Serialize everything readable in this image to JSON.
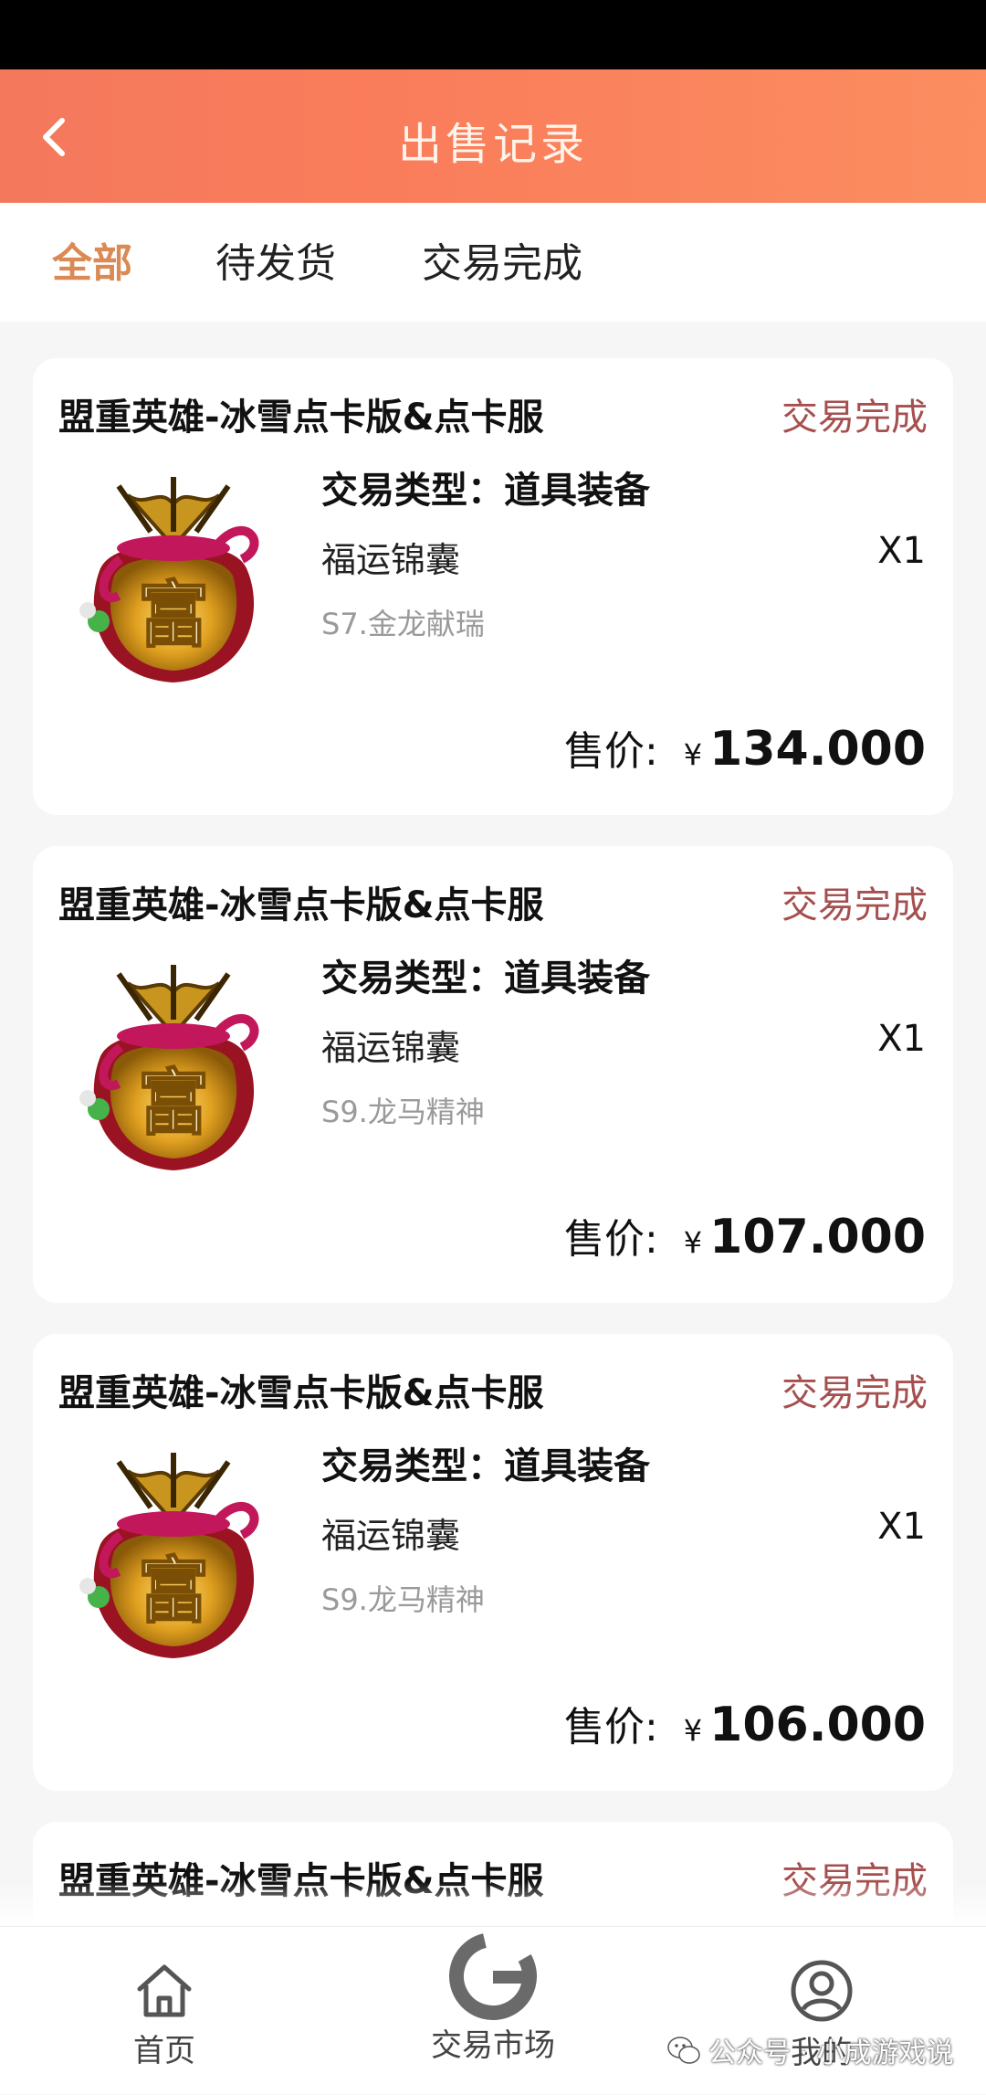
{
  "header": {
    "title": "出售记录"
  },
  "tabs": [
    {
      "label": "全部",
      "active": true
    },
    {
      "label": "待发货",
      "active": false
    },
    {
      "label": "交易完成",
      "active": false
    }
  ],
  "records": [
    {
      "game": "盟重英雄-冰雪点卡版&点卡服",
      "status": "交易完成",
      "trade_type": "交易类型：道具装备",
      "item": "福运锦囊",
      "quantity": "X1",
      "server": "S7.金龙献瑞",
      "price_label": "售价:",
      "currency": "¥",
      "price": "134.000"
    },
    {
      "game": "盟重英雄-冰雪点卡版&点卡服",
      "status": "交易完成",
      "trade_type": "交易类型：道具装备",
      "item": "福运锦囊",
      "quantity": "X1",
      "server": "S9.龙马精神",
      "price_label": "售价:",
      "currency": "¥",
      "price": "107.000"
    },
    {
      "game": "盟重英雄-冰雪点卡版&点卡服",
      "status": "交易完成",
      "trade_type": "交易类型：道具装备",
      "item": "福运锦囊",
      "quantity": "X1",
      "server": "S9.龙马精神",
      "price_label": "售价:",
      "currency": "¥",
      "price": "106.000"
    },
    {
      "game": "盟重英雄-冰雪点卡版&点卡服",
      "status": "交易完成"
    }
  ],
  "bottom_nav": [
    {
      "label": "首页",
      "icon": "home-icon"
    },
    {
      "label": "交易市场",
      "icon": "market-g-icon"
    },
    {
      "label": "我的",
      "icon": "user-icon"
    }
  ],
  "watermark": "公众号 · 小成游戏说",
  "colors": {
    "header_start": "#f4785c",
    "header_end": "#fb8d60",
    "tab_active": "#d98a55",
    "status": "#a64f4f"
  }
}
